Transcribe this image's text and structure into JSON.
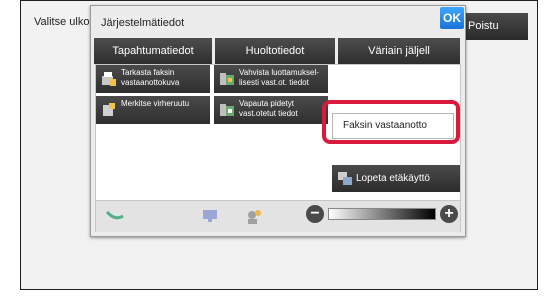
{
  "background": {
    "title": "Valitse ulkoi",
    "exit_label": "Poistu"
  },
  "dialog": {
    "title": "Järjestelmätiedot",
    "ok_label": "OK",
    "tabs": [
      "Tapahtumatiedot",
      "Huoltotiedot",
      "Väriain jäljell"
    ],
    "actions": [
      {
        "label": "Tarkasta faksin vastaanottokuva",
        "icon": "fax-image-icon"
      },
      {
        "label": "Vahvista luottamuksel- lisesti vast.ot. tiedot",
        "icon": "confidential-receive-icon"
      },
      {
        "label": "Merkitse virheruutu",
        "icon": "mark-error-icon"
      },
      {
        "label": "Vapauta pidetyt vast.otetut tiedot",
        "icon": "release-held-icon"
      }
    ],
    "fax_receive_label": "Faksin vastaanotto",
    "stop_remote_label": "Lopeta etäkäyttö",
    "highlight_color": "#d91a3c"
  }
}
